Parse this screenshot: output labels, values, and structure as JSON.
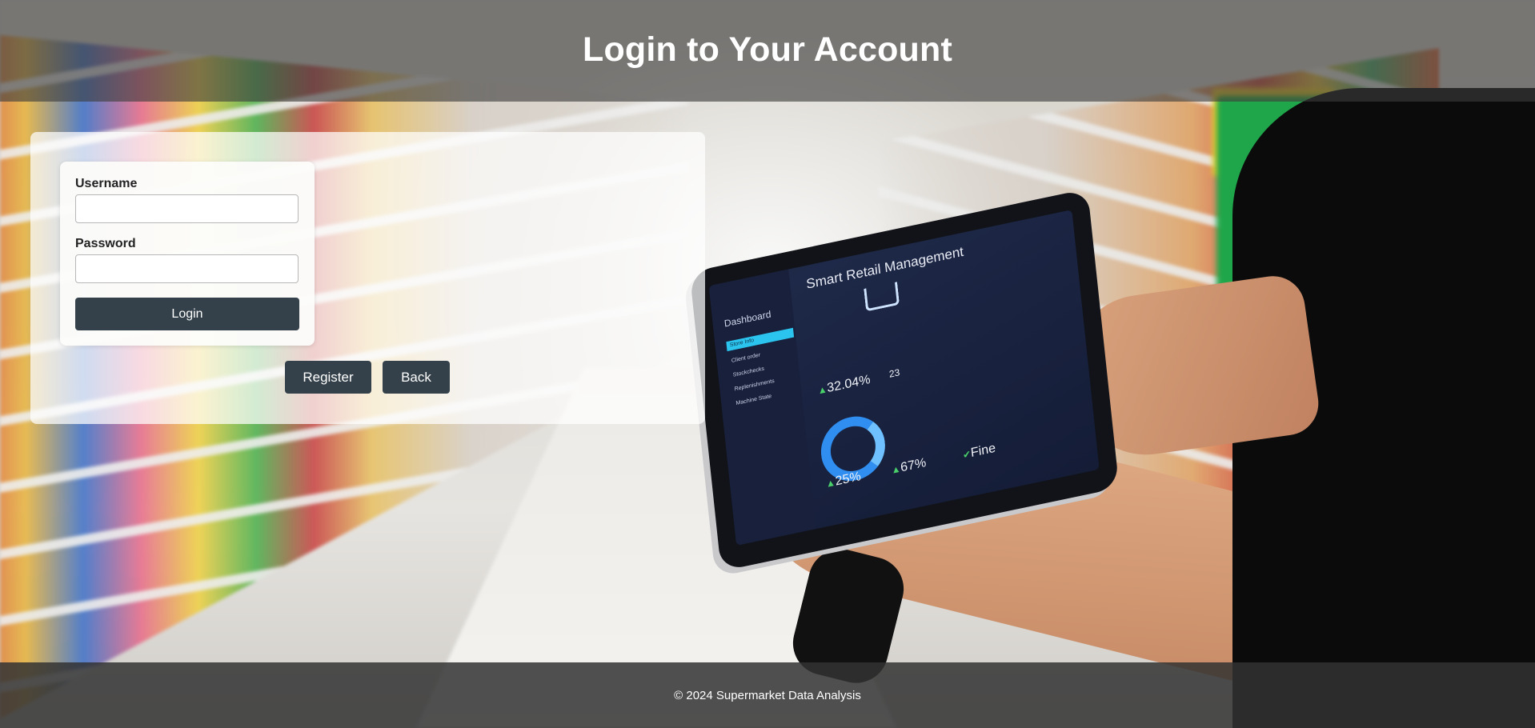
{
  "header": {
    "title": "Login to Your Account"
  },
  "login_form": {
    "username_label": "Username",
    "username_value": "",
    "password_label": "Password",
    "password_value": "",
    "login_button": "Login"
  },
  "actions": {
    "register_button": "Register",
    "back_button": "Back"
  },
  "background_tablet": {
    "title": "Smart Retail Management",
    "sidebar_heading": "Dashboard",
    "menu_items": [
      "Store Info",
      "Client order",
      "Stockchecks",
      "Replenishments",
      "Machine State"
    ],
    "kpis": [
      "32.04%",
      "23",
      "25%",
      "67%",
      "Fine"
    ]
  },
  "footer": {
    "copyright": "© 2024 Supermarket Data Analysis"
  },
  "colors": {
    "header_bg": "#3c3c3c",
    "button_bg": "#34414a",
    "button_text": "#ffffff",
    "footer_bg": "#323232"
  }
}
